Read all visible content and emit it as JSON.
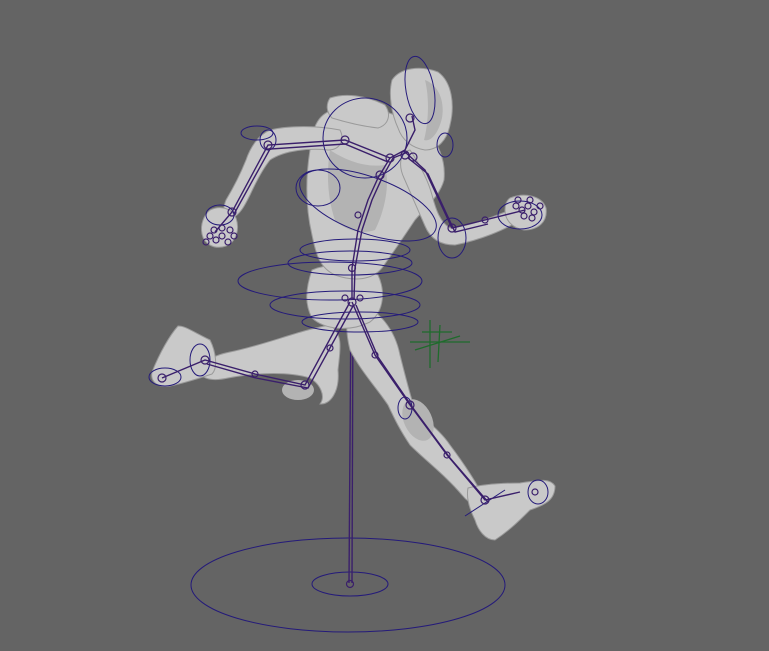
{
  "viewport": {
    "background": "#646464",
    "mesh_color": "#c9c9c9",
    "control_curve_color": "#241a7a",
    "joint_color": "#3a1f6b",
    "locator_color": "#1f6b2c"
  },
  "scene_objects": {
    "character": "running-humanoid-mesh",
    "rig": "skeleton-joints-and-fk-controls",
    "ground_control": "root-circle-control",
    "locator": "pivot-locator"
  }
}
